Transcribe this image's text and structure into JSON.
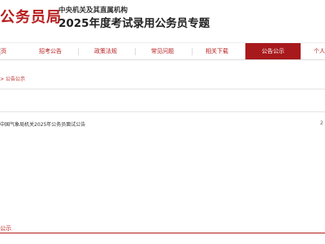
{
  "header": {
    "logo_text": "公务员局",
    "subtitle_top": "中央机关及其直属机构",
    "subtitle_main": "2025年度考试录用公务员专题"
  },
  "nav": {
    "items": [
      {
        "label": "首页"
      },
      {
        "label": "招考公告"
      },
      {
        "label": "政策法规"
      },
      {
        "label": "常见问题"
      },
      {
        "label": "相关下载"
      },
      {
        "label": "公告公示"
      },
      {
        "label": "个人"
      }
    ]
  },
  "breadcrumb": {
    "text": "> 公告公示"
  },
  "list": {
    "items": [
      {
        "title": "中国气象局机关2025年公务员面试公告",
        "date": "2"
      }
    ]
  },
  "footer": {
    "label": "公示"
  },
  "colors": {
    "accent": "#b71c1c",
    "nav_active_bg": "#a8191c"
  }
}
